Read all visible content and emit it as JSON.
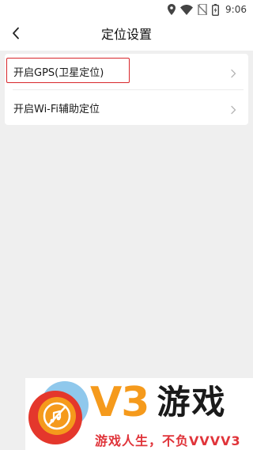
{
  "status_bar": {
    "time": "9:06",
    "icons": [
      "location-icon",
      "wifi-icon",
      "no-sim-icon",
      "battery-charging-icon"
    ]
  },
  "header": {
    "back_icon": "chevron-left-icon",
    "title": "定位设置"
  },
  "settings": {
    "items": [
      {
        "label": "开启GPS(卫星定位)",
        "icon": "chevron-right-icon",
        "highlighted": true
      },
      {
        "label": "开启Wi-Fi辅助定位",
        "icon": "chevron-right-icon",
        "highlighted": false
      }
    ],
    "highlight_color": "#d8262b"
  },
  "watermark": {
    "brand": "V3",
    "name": "游戏",
    "slogan": "游戏人生，不负VVVV3",
    "colors": {
      "brand": "#f59a1c",
      "slogan": "#e0343a",
      "logo_blue": "#8fc8ec",
      "logo_red": "#e4372c",
      "logo_orange": "#f59a1c"
    }
  },
  "colors": {
    "background": "#efefef",
    "surface": "#ffffff",
    "text": "#1a1a1a"
  }
}
